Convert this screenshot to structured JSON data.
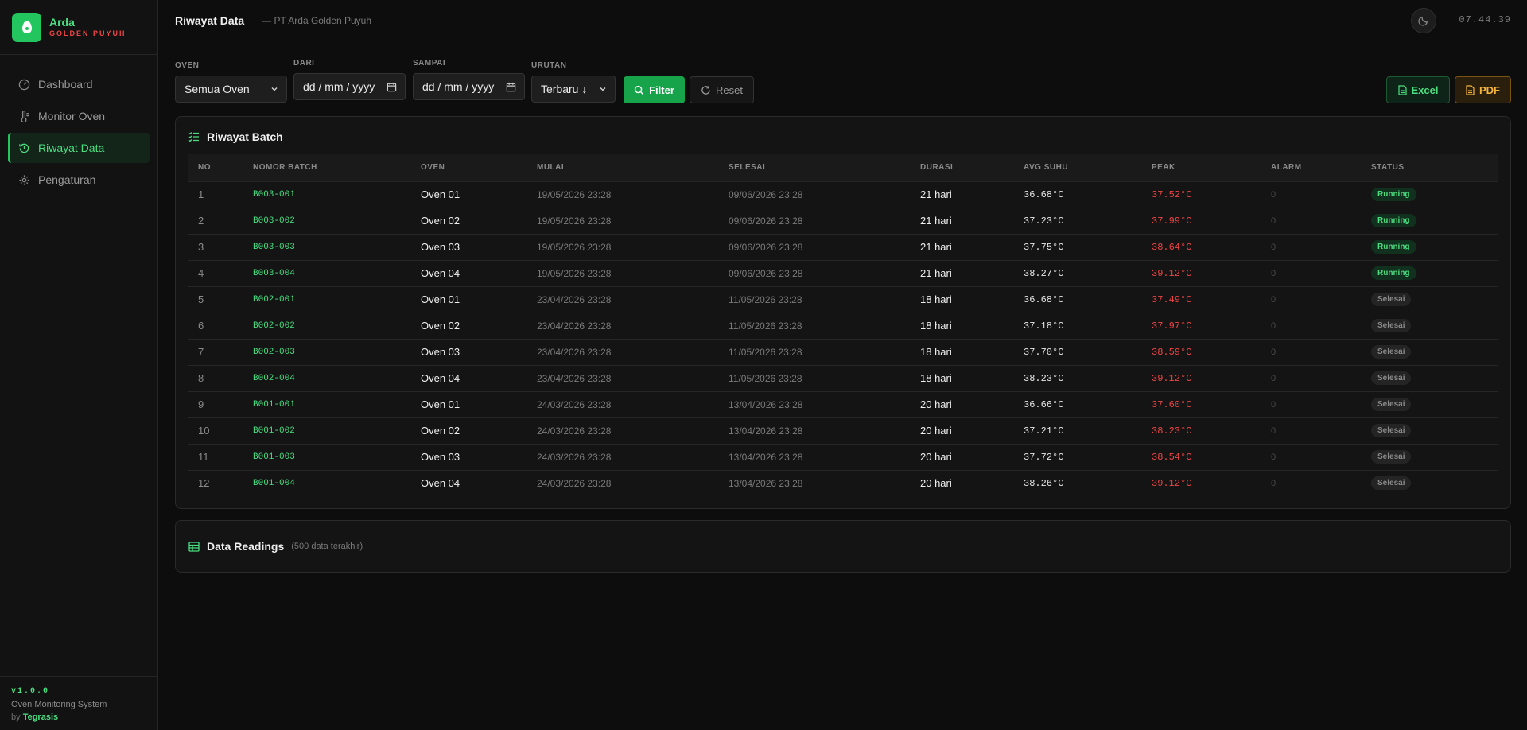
{
  "brand": {
    "name": "Arda",
    "sub": "GOLDEN PUYUH"
  },
  "sidebar": {
    "items": [
      {
        "label": "Dashboard",
        "icon": "gauge-icon"
      },
      {
        "label": "Monitor Oven",
        "icon": "thermometer-icon"
      },
      {
        "label": "Riwayat Data",
        "icon": "history-icon",
        "active": true
      },
      {
        "label": "Pengaturan",
        "icon": "gear-icon"
      }
    ],
    "footer": {
      "version": "v1.0.0",
      "system": "Oven Monitoring System",
      "by_prefix": "by",
      "by_name": "Tegrasis"
    }
  },
  "header": {
    "title": "Riwayat Data",
    "subtitle": "— PT Arda Golden Puyuh",
    "clock": "07.44.39"
  },
  "filters": {
    "oven": {
      "label": "OVEN",
      "value": "Semua Oven"
    },
    "dari": {
      "label": "DARI",
      "value": "dd / mm / yyyy"
    },
    "sampai": {
      "label": "SAMPAI",
      "value": "dd / mm / yyyy"
    },
    "urutan": {
      "label": "URUTAN",
      "value": "Terbaru ↓"
    },
    "filter_label": "Filter",
    "reset_label": "Reset",
    "excel_label": "Excel",
    "pdf_label": "PDF"
  },
  "batch_card": {
    "title": "Riwayat Batch",
    "columns": [
      "NO",
      "NOMOR BATCH",
      "OVEN",
      "MULAI",
      "SELESAI",
      "DURASI",
      "AVG SUHU",
      "PEAK",
      "ALARM",
      "STATUS"
    ],
    "rows": [
      {
        "no": "1",
        "batch": "B003-001",
        "oven": "Oven 01",
        "mulai": "19/05/2026 23:28",
        "selesai": "09/06/2026 23:28",
        "durasi": "21 hari",
        "avg": "36.68°C",
        "peak": "37.52°C",
        "alarm": "0",
        "status": "Running"
      },
      {
        "no": "2",
        "batch": "B003-002",
        "oven": "Oven 02",
        "mulai": "19/05/2026 23:28",
        "selesai": "09/06/2026 23:28",
        "durasi": "21 hari",
        "avg": "37.23°C",
        "peak": "37.99°C",
        "alarm": "0",
        "status": "Running"
      },
      {
        "no": "3",
        "batch": "B003-003",
        "oven": "Oven 03",
        "mulai": "19/05/2026 23:28",
        "selesai": "09/06/2026 23:28",
        "durasi": "21 hari",
        "avg": "37.75°C",
        "peak": "38.64°C",
        "alarm": "0",
        "status": "Running"
      },
      {
        "no": "4",
        "batch": "B003-004",
        "oven": "Oven 04",
        "mulai": "19/05/2026 23:28",
        "selesai": "09/06/2026 23:28",
        "durasi": "21 hari",
        "avg": "38.27°C",
        "peak": "39.12°C",
        "alarm": "0",
        "status": "Running"
      },
      {
        "no": "5",
        "batch": "B002-001",
        "oven": "Oven 01",
        "mulai": "23/04/2026 23:28",
        "selesai": "11/05/2026 23:28",
        "durasi": "18 hari",
        "avg": "36.68°C",
        "peak": "37.49°C",
        "alarm": "0",
        "status": "Selesai"
      },
      {
        "no": "6",
        "batch": "B002-002",
        "oven": "Oven 02",
        "mulai": "23/04/2026 23:28",
        "selesai": "11/05/2026 23:28",
        "durasi": "18 hari",
        "avg": "37.18°C",
        "peak": "37.97°C",
        "alarm": "0",
        "status": "Selesai"
      },
      {
        "no": "7",
        "batch": "B002-003",
        "oven": "Oven 03",
        "mulai": "23/04/2026 23:28",
        "selesai": "11/05/2026 23:28",
        "durasi": "18 hari",
        "avg": "37.70°C",
        "peak": "38.59°C",
        "alarm": "0",
        "status": "Selesai"
      },
      {
        "no": "8",
        "batch": "B002-004",
        "oven": "Oven 04",
        "mulai": "23/04/2026 23:28",
        "selesai": "11/05/2026 23:28",
        "durasi": "18 hari",
        "avg": "38.23°C",
        "peak": "39.12°C",
        "alarm": "0",
        "status": "Selesai"
      },
      {
        "no": "9",
        "batch": "B001-001",
        "oven": "Oven 01",
        "mulai": "24/03/2026 23:28",
        "selesai": "13/04/2026 23:28",
        "durasi": "20 hari",
        "avg": "36.66°C",
        "peak": "37.60°C",
        "alarm": "0",
        "status": "Selesai"
      },
      {
        "no": "10",
        "batch": "B001-002",
        "oven": "Oven 02",
        "mulai": "24/03/2026 23:28",
        "selesai": "13/04/2026 23:28",
        "durasi": "20 hari",
        "avg": "37.21°C",
        "peak": "38.23°C",
        "alarm": "0",
        "status": "Selesai"
      },
      {
        "no": "11",
        "batch": "B001-003",
        "oven": "Oven 03",
        "mulai": "24/03/2026 23:28",
        "selesai": "13/04/2026 23:28",
        "durasi": "20 hari",
        "avg": "37.72°C",
        "peak": "38.54°C",
        "alarm": "0",
        "status": "Selesai"
      },
      {
        "no": "12",
        "batch": "B001-004",
        "oven": "Oven 04",
        "mulai": "24/03/2026 23:28",
        "selesai": "13/04/2026 23:28",
        "durasi": "20 hari",
        "avg": "38.26°C",
        "peak": "39.12°C",
        "alarm": "0",
        "status": "Selesai"
      }
    ]
  },
  "readings_card": {
    "title": "Data Readings",
    "note": "(500 data terakhir)"
  },
  "colors": {
    "accent": "#22c55e",
    "peak": "#ef4444",
    "pdf": "#f5b53c"
  }
}
